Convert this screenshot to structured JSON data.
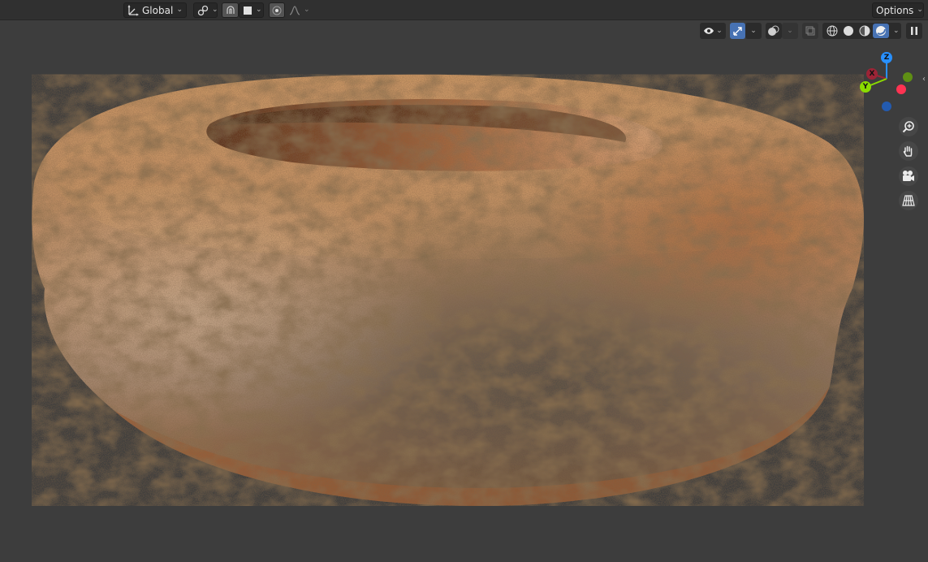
{
  "header": {
    "orientation": {
      "label": "Global",
      "icon": "transform-orientation-icon"
    },
    "pivot_icon": "link-icon",
    "snap_icon": "magnet-icon",
    "snap_target_icon": "square-icon",
    "proportional_icon": "dot-circle-icon",
    "falloff_icon": "falloff-curve-icon",
    "options_label": "Options"
  },
  "viewport": {
    "toolbar": {
      "visibility_icon": "eye-icon",
      "gizmo_icon": "gizmo-arrows-icon",
      "overlay_icon": "overlay-circles-icon",
      "xray_icon": "xray-icon",
      "shading_modes": [
        "wireframe",
        "solid",
        "material",
        "rendered"
      ],
      "active_shading": "rendered"
    },
    "gizmo": {
      "z_label": "Z",
      "x_label": "X",
      "y_label": "Y",
      "colors": {
        "x": "#ff3352",
        "y": "#8bdc00",
        "z": "#2890ff",
        "x_neg": "#9c2436",
        "y_neg": "#5f8f14",
        "z_neg": "#235bb0"
      }
    },
    "nav_icons": [
      "zoom-icon",
      "hand-icon",
      "camera-icon",
      "grid-icon"
    ]
  }
}
